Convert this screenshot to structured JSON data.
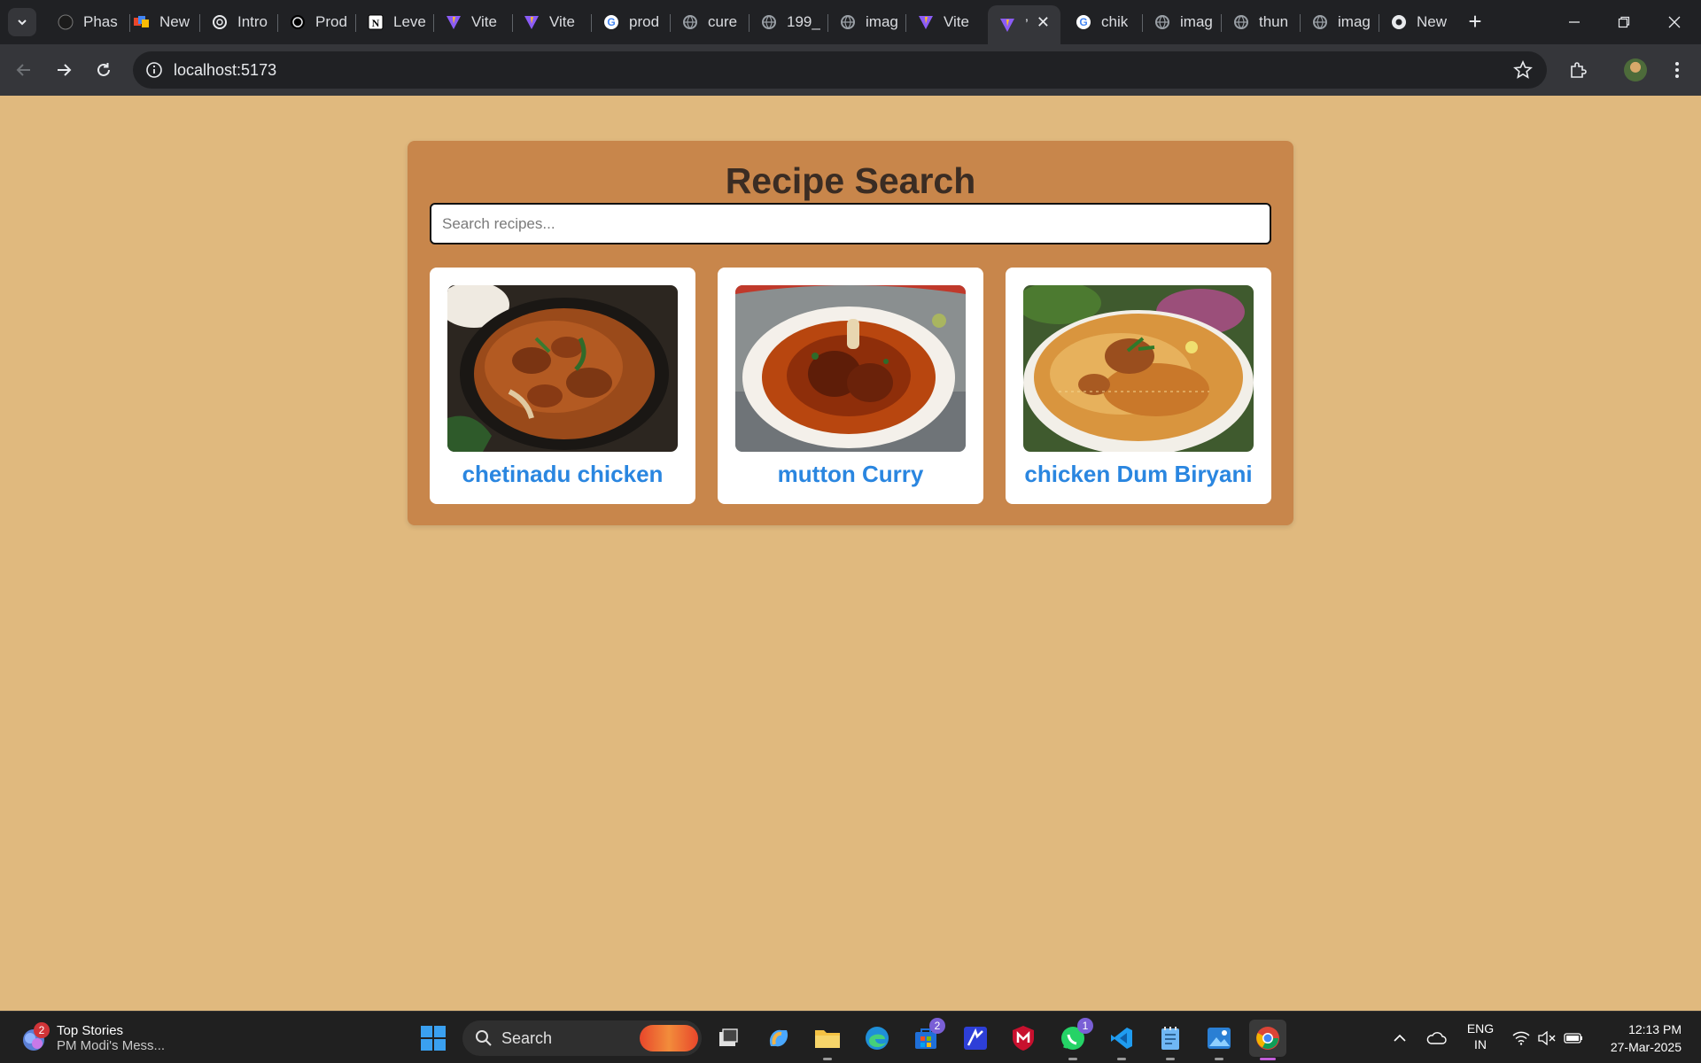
{
  "browser": {
    "tabs": [
      {
        "title": "Phas",
        "favicon": "github-icon"
      },
      {
        "title": "New",
        "favicon": "notebook-icon"
      },
      {
        "title": "Intro",
        "favicon": "openai-icon"
      },
      {
        "title": "Prod",
        "favicon": "openai-icon"
      },
      {
        "title": "Leve",
        "favicon": "notion-icon"
      },
      {
        "title": "Vite",
        "favicon": "vite-icon"
      },
      {
        "title": "Vite",
        "favicon": "vite-icon"
      },
      {
        "title": "prod",
        "favicon": "google-icon"
      },
      {
        "title": "cure",
        "favicon": "globe-icon"
      },
      {
        "title": "199_",
        "favicon": "globe-icon"
      },
      {
        "title": "imag",
        "favicon": "globe-icon"
      },
      {
        "title": "Vite",
        "favicon": "vite-icon"
      },
      {
        "title": "’",
        "favicon": "vite-icon",
        "active": true
      },
      {
        "title": "chik",
        "favicon": "google-icon"
      },
      {
        "title": "imag",
        "favicon": "globe-icon"
      },
      {
        "title": "thun",
        "favicon": "globe-icon"
      },
      {
        "title": "imag",
        "favicon": "globe-icon"
      },
      {
        "title": "New",
        "favicon": "chrome-icon"
      }
    ],
    "url": "localhost:5173"
  },
  "page": {
    "title": "Recipe Search",
    "search_placeholder": "Search recipes...",
    "search_value": "",
    "recipes": [
      {
        "name": "chetinadu chicken",
        "image": "chicken-curry-photo"
      },
      {
        "name": "mutton Curry",
        "image": "mutton-curry-photo"
      },
      {
        "name": "chicken Dum Biryani",
        "image": "chicken-biryani-photo"
      }
    ]
  },
  "colors": {
    "page_background": "#e0b97e",
    "panel_background": "#c8864b",
    "title_color": "#3a2c23",
    "recipe_name_color": "#2a86e0"
  },
  "taskbar": {
    "news_title": "Top Stories",
    "news_subtitle": "PM Modi's Mess...",
    "news_badge": "2",
    "search_label": "Search",
    "store_badge": "2",
    "whatsapp_badge": "1",
    "language_line1": "ENG",
    "language_line2": "IN",
    "time": "12:13 PM",
    "date": "27-Mar-2025"
  }
}
